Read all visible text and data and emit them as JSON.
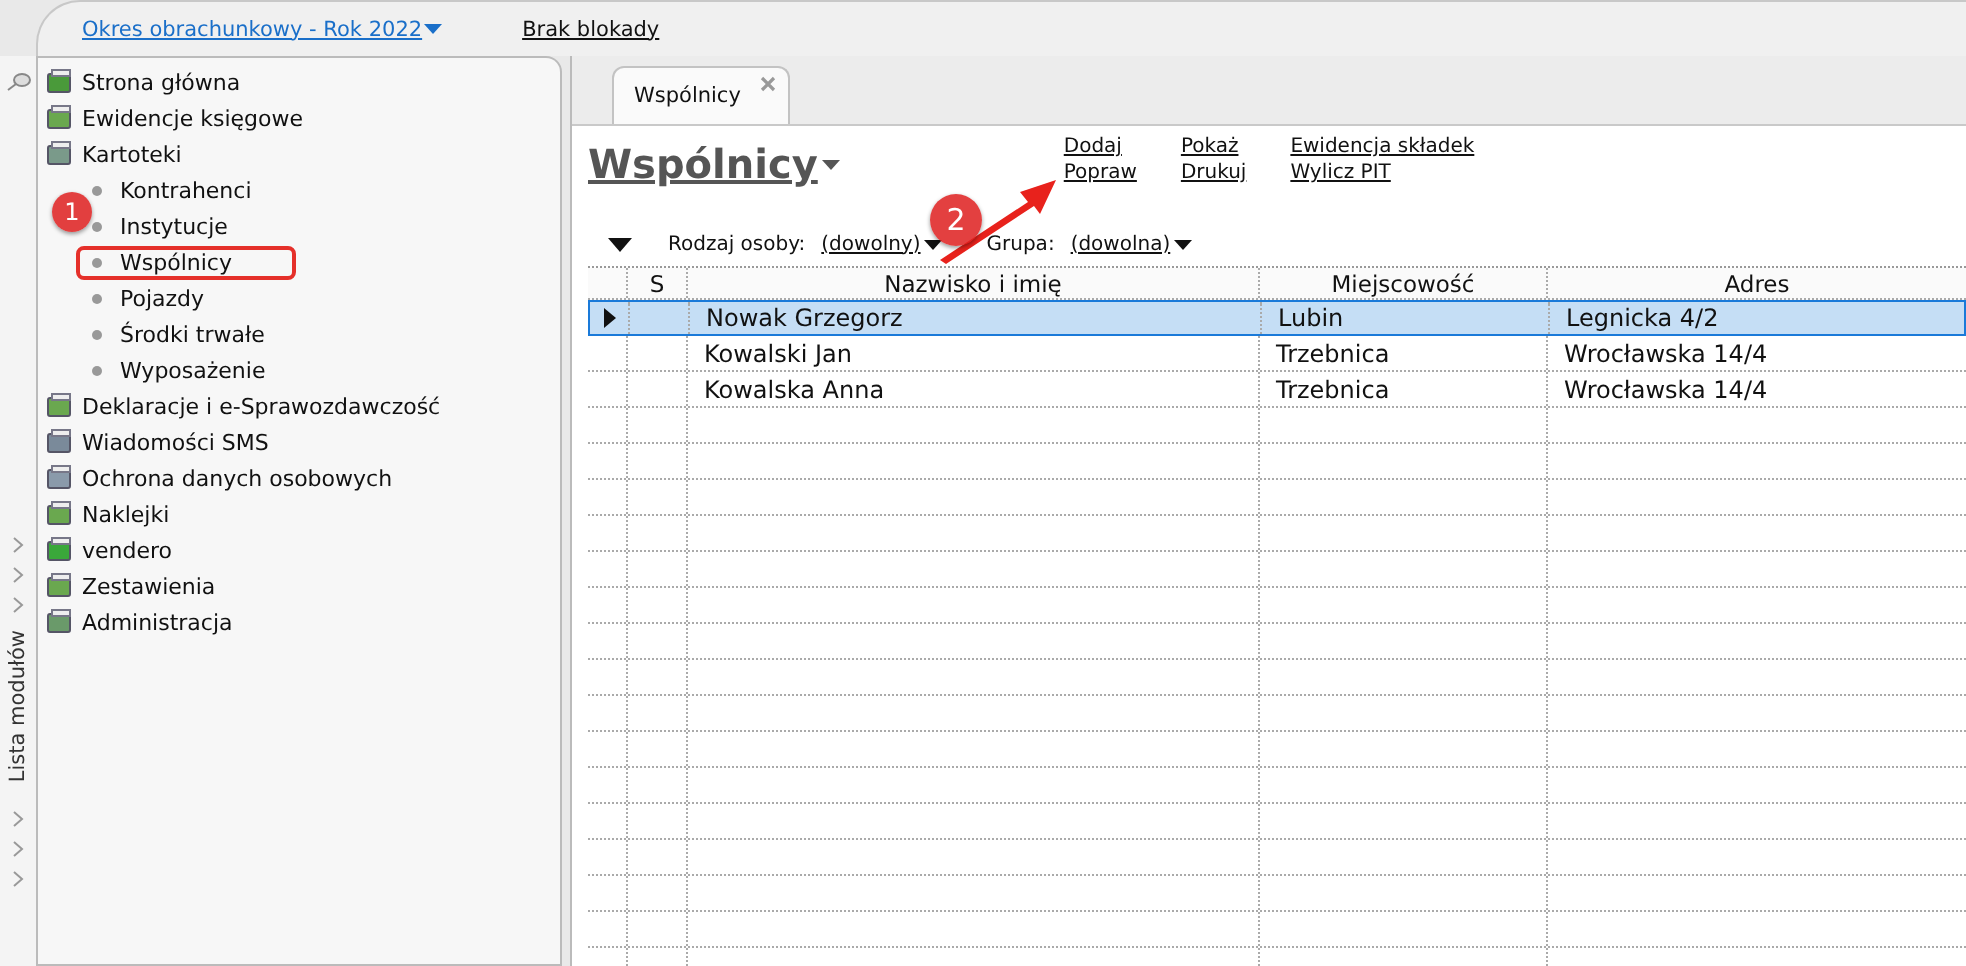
{
  "top_bar": {
    "period_link": "Okres obrachunkowy - Rok 2022",
    "lock_status": "Brak blokady"
  },
  "sidebar": {
    "strip_label": "Lista modułów",
    "items": [
      {
        "label": "Strona główna"
      },
      {
        "label": "Ewidencje księgowe"
      },
      {
        "label": "Kartoteki",
        "children": [
          {
            "label": "Kontrahenci",
            "marked": false
          },
          {
            "label": "Instytucje",
            "marked": false
          },
          {
            "label": "Wspólnicy",
            "marked": true
          },
          {
            "label": "Pojazdy",
            "marked": false
          },
          {
            "label": "Środki trwałe",
            "marked": false
          },
          {
            "label": "Wyposażenie",
            "marked": false
          }
        ]
      },
      {
        "label": "Deklaracje i e-Sprawozdawczość"
      },
      {
        "label": "Wiadomości SMS"
      },
      {
        "label": "Ochrona danych osobowych"
      },
      {
        "label": "Naklejki"
      },
      {
        "label": "vendero"
      },
      {
        "label": "Zestawienia"
      },
      {
        "label": "Administracja"
      }
    ]
  },
  "tabs": [
    {
      "label": "Wspólnicy",
      "selected": true
    }
  ],
  "page": {
    "title": "Wspólnicy",
    "actions": [
      [
        "Dodaj",
        "Popraw"
      ],
      [
        "Pokaż",
        "Drukuj"
      ],
      [
        "Ewidencja składek",
        "Wylicz PIT"
      ]
    ],
    "filters": [
      {
        "label": "Rodzaj osoby:",
        "value": "(dowolny)"
      },
      {
        "label": "Grupa:",
        "value": "(dowolna)"
      }
    ]
  },
  "table": {
    "columns": [
      "S",
      "Nazwisko i imię",
      "Miejscowość",
      "Adres"
    ],
    "rows": [
      {
        "s": "",
        "name": "Nowak Grzegorz",
        "city": "Lubin",
        "address": "Legnicka 4/2",
        "selected": true
      },
      {
        "s": "",
        "name": "Kowalski Jan",
        "city": "Trzebnica",
        "address": "Wrocławska 14/4",
        "selected": false
      },
      {
        "s": "",
        "name": "Kowalska Anna",
        "city": "Trzebnica",
        "address": "Wrocławska 14/4",
        "selected": false
      }
    ]
  },
  "annotations": [
    {
      "number": "1"
    },
    {
      "number": "2"
    }
  ]
}
